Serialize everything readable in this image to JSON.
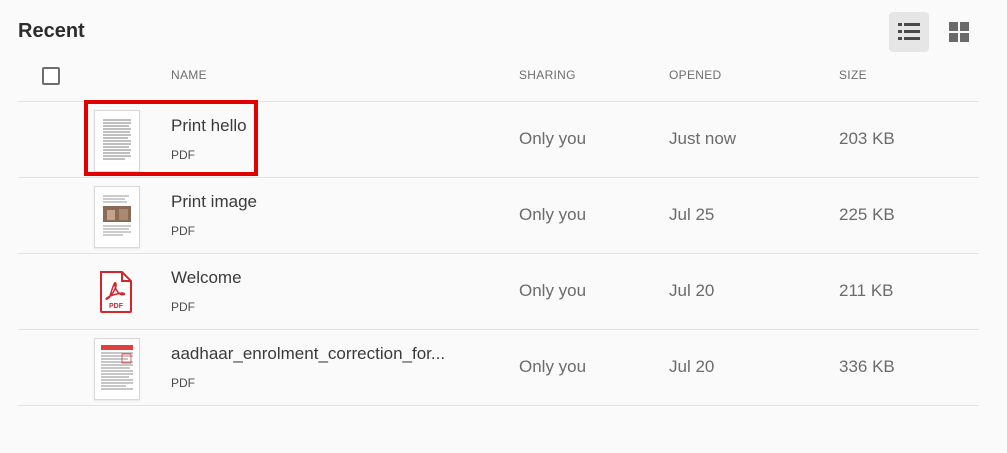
{
  "section": {
    "title": "Recent"
  },
  "view_toggle": {
    "list_icon": "list-view-icon",
    "grid_icon": "grid-view-icon"
  },
  "columns": {
    "name": "NAME",
    "sharing": "SHARING",
    "opened": "OPENED",
    "size": "SIZE"
  },
  "files": [
    {
      "name": "Print hello",
      "type": "PDF",
      "sharing": "Only you",
      "opened": "Just now",
      "size": "203 KB",
      "thumb": "text-document-thumbnail"
    },
    {
      "name": "Print image",
      "type": "PDF",
      "sharing": "Only you",
      "opened": "Jul 25",
      "size": "225 KB",
      "thumb": "image-document-thumbnail"
    },
    {
      "name": "Welcome",
      "type": "PDF",
      "sharing": "Only you",
      "opened": "Jul 20",
      "size": "211 KB",
      "thumb": "pdf-icon"
    },
    {
      "name": "aadhaar_enrolment_correction_for...",
      "type": "PDF",
      "sharing": "Only you",
      "opened": "Jul 20",
      "size": "336 KB",
      "thumb": "form-document-thumbnail"
    }
  ],
  "colors": {
    "accent_red": "#e00000",
    "pdf_red": "#d7262b",
    "text": "#2c2c2c",
    "muted": "#6b6b6b"
  }
}
